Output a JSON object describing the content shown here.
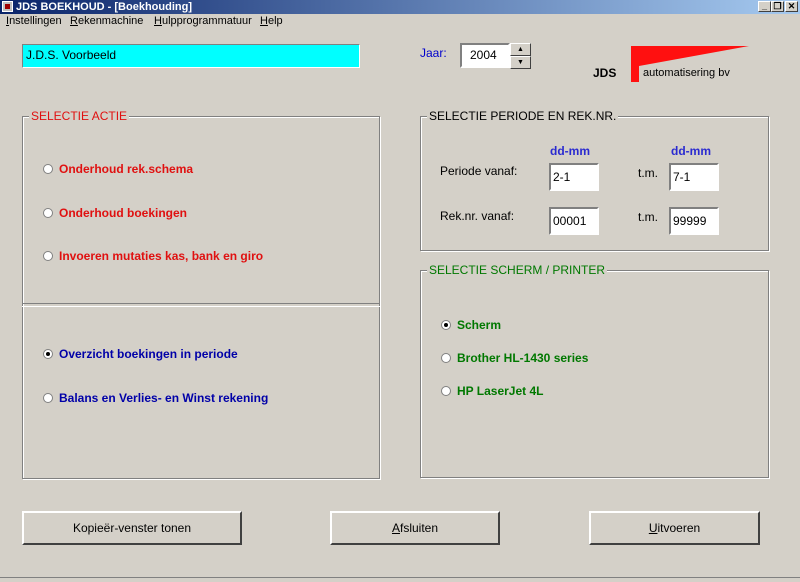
{
  "window": {
    "title": "JDS BOEKHOUD - [Boekhouding]",
    "controls": {
      "minimize": "_",
      "restore": "❐",
      "close": "✕"
    }
  },
  "menu": [
    "Instellingen",
    "Rekenmachine",
    "Hulpprogrammatuur",
    "Help"
  ],
  "company_name": "J.D.S. Voorbeeld",
  "jaar": {
    "label": "Jaar:",
    "value": "2004"
  },
  "logo": {
    "text": "JDS",
    "subtext": "automatisering bv"
  },
  "selectie_actie": {
    "title": "SELECTIE ACTIE",
    "top_options": [
      {
        "label": "Onderhoud rek.schema",
        "selected": false
      },
      {
        "label": "Onderhoud boekingen",
        "selected": false
      },
      {
        "label": "Invoeren mutaties kas, bank en giro",
        "selected": false
      }
    ],
    "bottom_options": [
      {
        "label": "Overzicht boekingen in periode",
        "selected": true
      },
      {
        "label": "Balans en Verlies- en Winst rekening",
        "selected": false
      }
    ]
  },
  "selectie_periode": {
    "title": "SELECTIE PERIODE  EN  REK.NR.",
    "col_header": "dd-mm",
    "periode_label": "Periode vanaf:",
    "periode_from": "2-1",
    "tm_label": "t.m.",
    "periode_to": "7-1",
    "reknr_label": "Rek.nr. vanaf:",
    "reknr_from": "00001",
    "reknr_to": "99999"
  },
  "selectie_scherm": {
    "title": "SELECTIE SCHERM / PRINTER",
    "options": [
      {
        "label": "Scherm",
        "selected": true
      },
      {
        "label": "Brother HL-1430 series",
        "selected": false
      },
      {
        "label": "HP LaserJet 4L",
        "selected": false
      }
    ]
  },
  "buttons": {
    "kopieer": "Kopieër-venster tonen",
    "afsluiten_first": "A",
    "afsluiten_rest": "fsluiten",
    "uitvoeren_first": "U",
    "uitvoeren_rest": "itvoeren"
  }
}
